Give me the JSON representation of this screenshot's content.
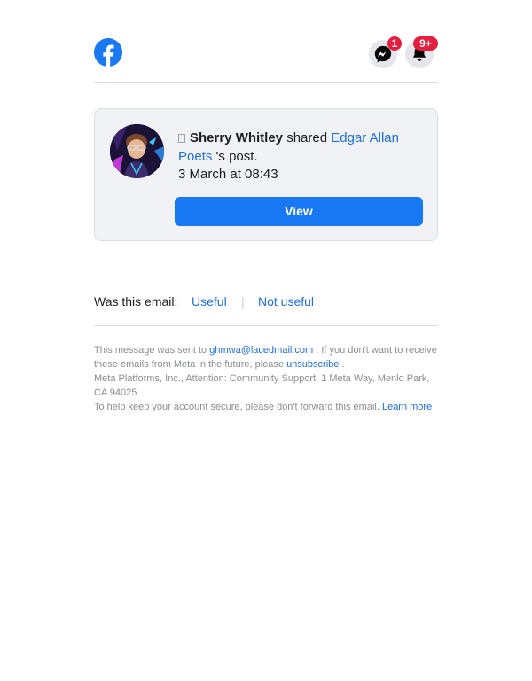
{
  "header": {
    "logo_icon": "facebook-logo-icon",
    "messenger_icon": "messenger-icon",
    "messenger_badge": "1",
    "notifications_icon": "bell-icon",
    "notifications_badge": "9+"
  },
  "notification": {
    "actor": "Sherry Whitley",
    "verb": "shared",
    "page": "Edgar Allan Poets",
    "object": "'s post.",
    "timestamp": "3 March at 08:43",
    "view_button": "View"
  },
  "feedback": {
    "question": "Was this email:",
    "useful": "Useful",
    "separator": "|",
    "not_useful": "Not useful"
  },
  "footer": {
    "sent_to_prefix": "This message was sent to",
    "email": "ghmwa@lacedmail.com",
    "unsubscribe_prefix": ". If you don't want to receive these emails from Meta in the future, please",
    "unsubscribe": "unsubscribe",
    "unsubscribe_suffix": ".",
    "address": "Meta Platforms, Inc., Attention: Community Support, 1 Meta Way, Menlo Park, CA 94025",
    "security_note": "To help keep your account secure, please don't forward this email.",
    "learn_more": "Learn more"
  },
  "colors": {
    "brand_blue": "#1877f2",
    "link_blue": "#216fdb",
    "badge_red": "#e41e3f",
    "card_bg": "#f0f2f5"
  }
}
